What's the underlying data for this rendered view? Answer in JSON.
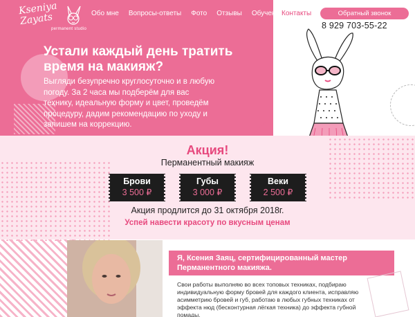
{
  "logo": {
    "line1": "Kseniya",
    "line2": "Zayats",
    "studio": "permanent studio"
  },
  "nav": {
    "items": [
      {
        "label": "Обо мне"
      },
      {
        "label": "Вопросы-ответы"
      },
      {
        "label": "Фото"
      },
      {
        "label": "Отзывы"
      },
      {
        "label": "Обучение"
      }
    ],
    "contacts_label": "Контакты",
    "callback_label": "Обратный звонок",
    "phone": "8 929 703-55-22"
  },
  "hero": {
    "title": "Устали каждый день тратить время на макияж?",
    "text": "Выгляди безупречно круглосуточно и в любую погоду. За 2 часа мы подберём для вас технику, идеальную форму и цвет, проведём процедуру, дадим рекомендацию по уходу и запишем на коррекцию."
  },
  "promo": {
    "title": "Акция!",
    "subtitle": "Перманентный макияж",
    "tickets": [
      {
        "name": "Брови",
        "price": "3 500 ₽"
      },
      {
        "name": "Губы",
        "price": "3 000 ₽"
      },
      {
        "name": "Веки",
        "price": "2 500 ₽"
      }
    ],
    "until": "Акция продлится до 31 октября 2018г.",
    "cta": "Успей навести красоту по вкусным ценам"
  },
  "about": {
    "title": "Я, Ксения Заяц, сертифицированный мастер Перманентного макияжа.",
    "text": "Свои работы выполняю во всех топовых техниках, подбираю индивидуальную форму бровей для каждого клиента, исправляю асимметрию бровей и губ, работаю в любых губных техниках от эффекта нюд (бесконтурная лёгкая техника) до эффекта губной помады."
  },
  "colors": {
    "pink": "#ec6d96",
    "pink_dark": "#e7497e",
    "pink_light": "#fde6ee",
    "ticket_bg": "#1d1d1d"
  }
}
